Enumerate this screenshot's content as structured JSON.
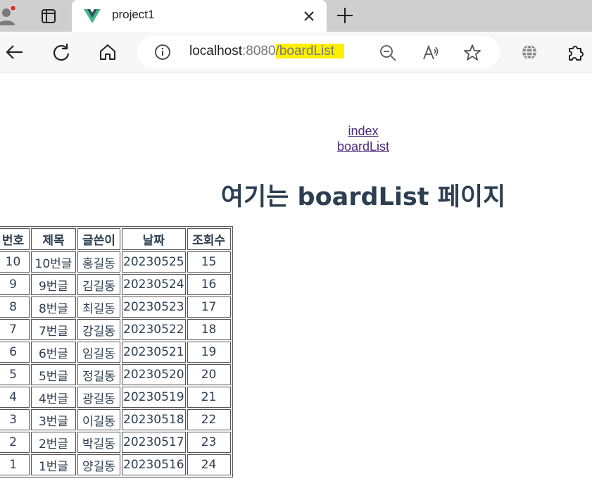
{
  "browser": {
    "tab_title": "project1",
    "url_host": "localhost",
    "url_port": ":8080",
    "url_path": "/boardList",
    "highlight_color": "#ffef00",
    "vue_colors": [
      "#41b883",
      "#34495e"
    ]
  },
  "nav": {
    "links": [
      "index",
      "boardList"
    ]
  },
  "page": {
    "heading": "여기는 boardList 페이지"
  },
  "table": {
    "headers": [
      "번호",
      "제목",
      "글쓴이",
      "날짜",
      "조회수"
    ],
    "rows": [
      [
        "10",
        "10번글",
        "홍길동",
        "20230525",
        "15"
      ],
      [
        "9",
        "9번글",
        "김길동",
        "20230524",
        "16"
      ],
      [
        "8",
        "8번글",
        "최길동",
        "20230523",
        "17"
      ],
      [
        "7",
        "7번글",
        "강길동",
        "20230522",
        "18"
      ],
      [
        "6",
        "6번글",
        "임길동",
        "20230521",
        "19"
      ],
      [
        "5",
        "5번글",
        "정길동",
        "20230520",
        "20"
      ],
      [
        "4",
        "4번글",
        "광길동",
        "20230519",
        "21"
      ],
      [
        "3",
        "3번글",
        "이길동",
        "20230518",
        "22"
      ],
      [
        "2",
        "2번글",
        "박길동",
        "20230517",
        "23"
      ],
      [
        "1",
        "1번글",
        "양길동",
        "20230516",
        "24"
      ]
    ]
  }
}
